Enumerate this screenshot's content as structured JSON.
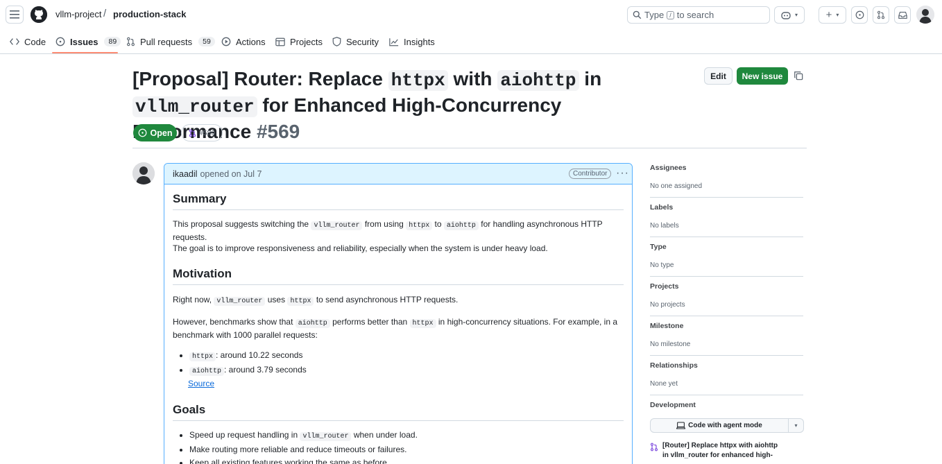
{
  "header": {
    "owner": "vllm-project",
    "separator": "/",
    "repo": "production-stack",
    "search_prefix": "Type",
    "search_key": "/",
    "search_suffix": "to search"
  },
  "repo_nav": [
    {
      "label": "Code",
      "icon": "code-icon"
    },
    {
      "label": "Issues",
      "count": "89",
      "icon": "issue-opened-icon",
      "active": true
    },
    {
      "label": "Pull requests",
      "count": "59",
      "icon": "git-pull-request-icon"
    },
    {
      "label": "Actions",
      "icon": "play-icon"
    },
    {
      "label": "Projects",
      "icon": "table-icon"
    },
    {
      "label": "Security",
      "icon": "shield-icon"
    },
    {
      "label": "Insights",
      "icon": "graph-icon"
    }
  ],
  "issue": {
    "title_part1": "[Proposal] Router: Replace ",
    "title_code1": "httpx",
    "title_part2": " with ",
    "title_code2": "aiohttp",
    "title_part3": " in ",
    "title_code3": "vllm_router",
    "title_part4": " for Enhanced High-Concurrency Performance ",
    "number": "#569",
    "edit_label": "Edit",
    "new_issue_label": "New issue",
    "state": "Open",
    "linked_pr": "#589",
    "accent_color": "#1f883d"
  },
  "comment": {
    "author": "ikaadil",
    "opened_text": "opened on Jul 7",
    "role": "Contributor",
    "summary_heading": "Summary",
    "summary_p_1": "This proposal suggests switching the",
    "summary_code_1": "vllm_router",
    "summary_p_2": "from using",
    "summary_code_2": "httpx",
    "summary_p_3": "to",
    "summary_code_3": "aiohttp",
    "summary_p_4": "for handling asynchronous HTTP requests.",
    "summary_line2": "The goal is to improve responsiveness and reliability, especially when the system is under heavy load.",
    "motivation_heading": "Motivation",
    "mot_p1_1": "Right now,",
    "mot_p1_code1": "vllm_router",
    "mot_p1_2": "uses",
    "mot_p1_code2": "httpx",
    "mot_p1_3": "to send asynchronous HTTP requests.",
    "mot_p2_1": "However, benchmarks show that",
    "mot_p2_code1": "aiohttp",
    "mot_p2_2": "performs better than",
    "mot_p2_code2": "httpx",
    "mot_p2_3": "in high-concurrency situations. For example, in a",
    "mot_p2_line2": "benchmark with 1000 parallel requests:",
    "bench": [
      {
        "code": "httpx",
        "text": ": around 10.22 seconds"
      },
      {
        "code": "aiohttp",
        "text": ": around 3.79 seconds"
      }
    ],
    "source_link": "Source",
    "goals_heading": "Goals",
    "goal1_1": "Speed up request handling in",
    "goal1_code": "vllm_router",
    "goal1_2": "when under load.",
    "goal2": "Make routing more reliable and reduce timeouts or failures.",
    "goal3": "Keep all existing features working the same as before."
  },
  "sidebar": {
    "assignees_title": "Assignees",
    "assignees_value": "No one assigned",
    "labels_title": "Labels",
    "labels_value": "No labels",
    "type_title": "Type",
    "type_value": "No type",
    "projects_title": "Projects",
    "projects_value": "No projects",
    "milestone_title": "Milestone",
    "milestone_value": "No milestone",
    "relationships_title": "Relationships",
    "relationships_value": "None yet",
    "development_title": "Development",
    "agent_button": "Code with agent mode",
    "linked_pr_title": "[Router] Replace httpx with aiohttp in vllm_router for enhanced high-"
  }
}
